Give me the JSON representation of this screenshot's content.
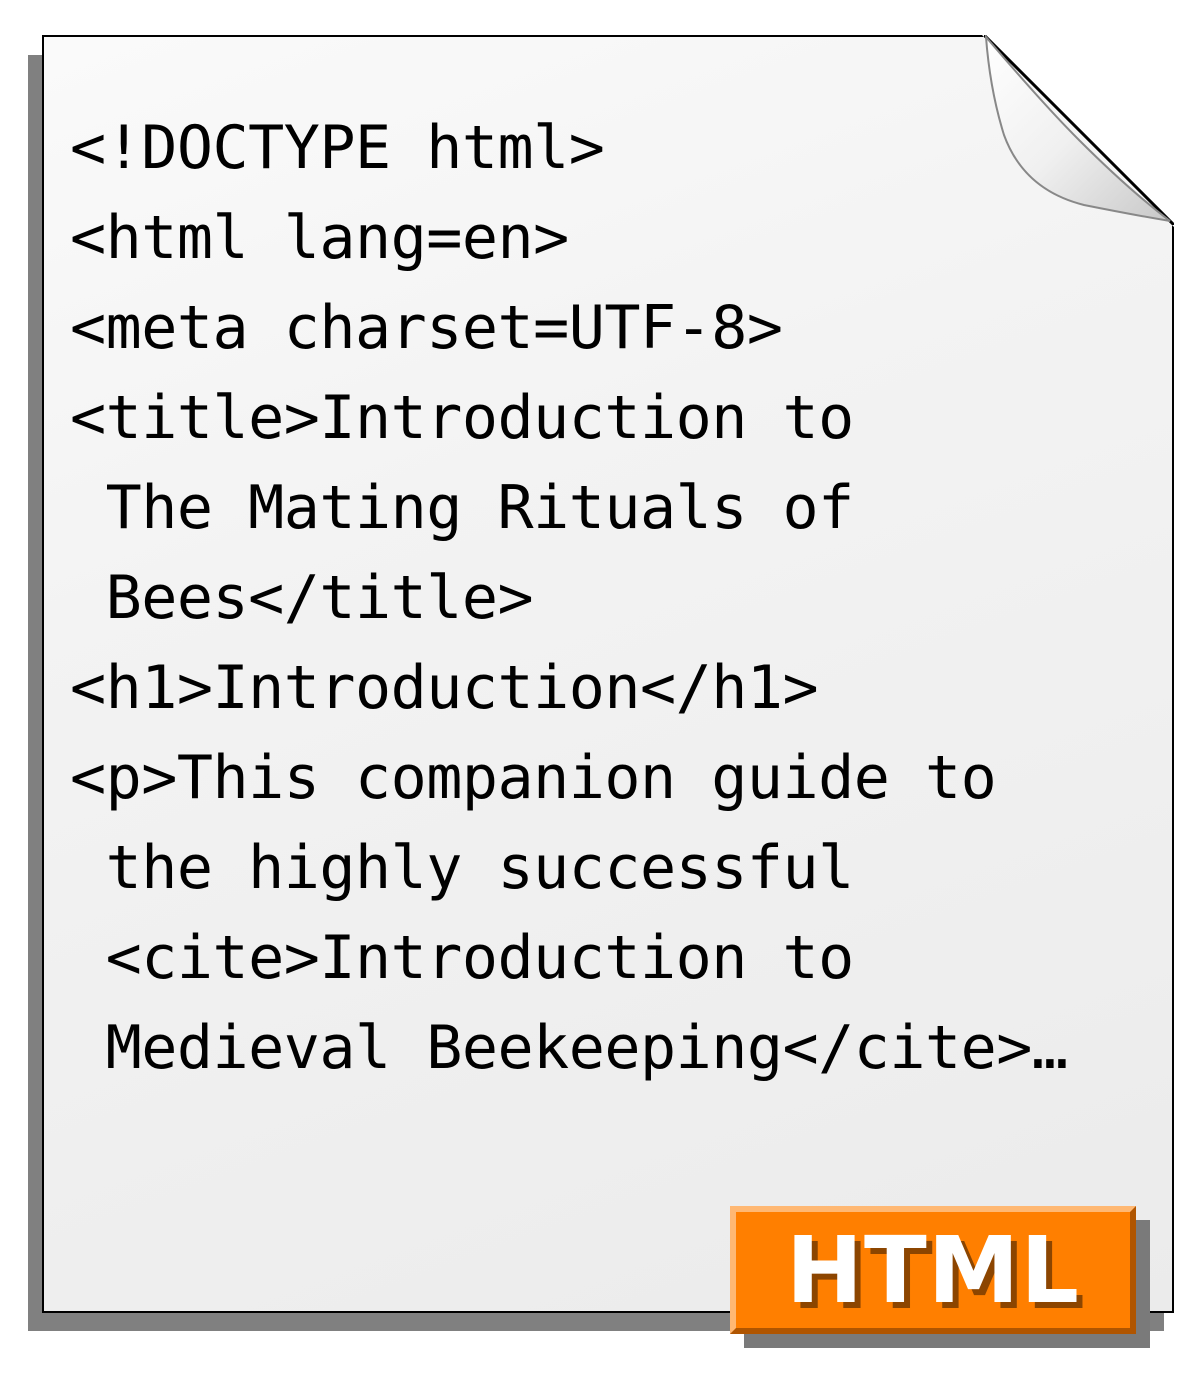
{
  "code": {
    "line1": "<!DOCTYPE html>",
    "line2": "<html lang=en>",
    "line3": "<meta charset=UTF-8>",
    "line4": "<title>Introduction to",
    "line5": " The Mating Rituals of",
    "line6": " Bees</title>",
    "line7": "<h1>Introduction</h1>",
    "line8": "<p>This companion guide to",
    "line9": " the highly successful",
    "line10": " <cite>Introduction to",
    "line11": " Medieval Beekeeping</cite>…"
  },
  "badge": {
    "label": "HTML"
  }
}
